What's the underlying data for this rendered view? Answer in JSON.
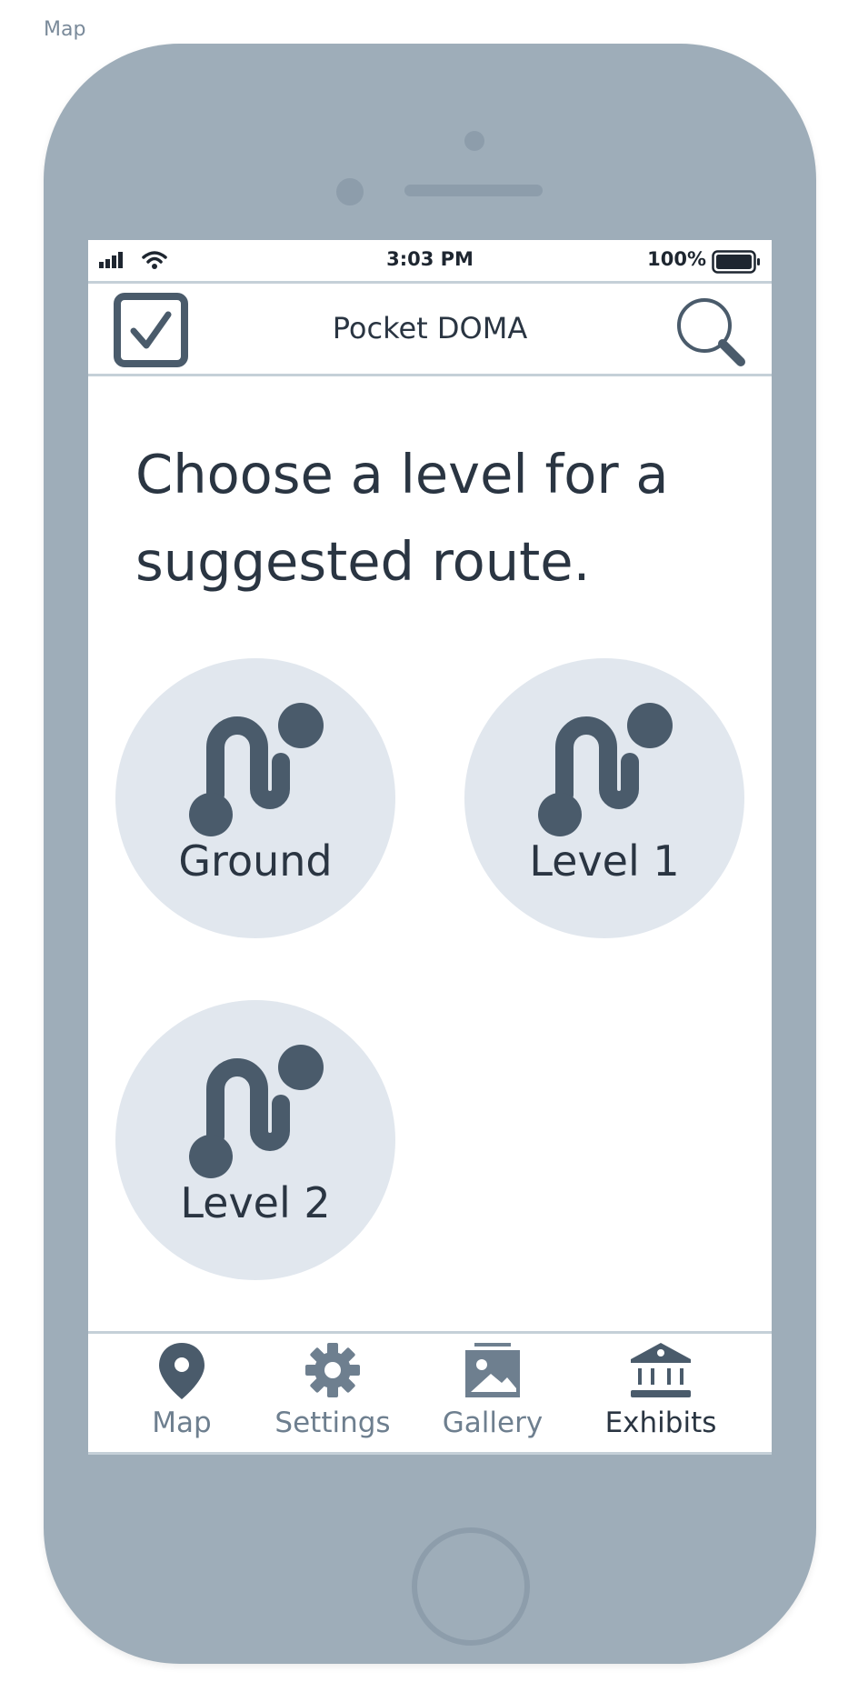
{
  "frame_label": "Map",
  "status_bar": {
    "time": "3:03 PM",
    "battery": "100%",
    "icons": [
      "signal-icon",
      "wifi-icon",
      "battery-icon"
    ]
  },
  "nav_bar": {
    "title": "Pocket DOMA",
    "left_icon": "checkbox-icon",
    "right_icon": "search-icon"
  },
  "headline": "Choose a level for a suggested route.",
  "levels": [
    {
      "label": "Ground",
      "icon": "route-icon"
    },
    {
      "label": "Level 1",
      "icon": "route-icon"
    },
    {
      "label": "Level 2",
      "icon": "route-icon"
    }
  ],
  "tabs": [
    {
      "label": "Map",
      "icon": "map-pin-icon",
      "active": false
    },
    {
      "label": "Settings",
      "icon": "gear-icon",
      "active": false
    },
    {
      "label": "Gallery",
      "icon": "gallery-icon",
      "active": false
    },
    {
      "label": "Exhibits",
      "icon": "museum-icon",
      "active": true
    }
  ],
  "colors": {
    "device": "#9eadb9",
    "text_dark": "#2a3542",
    "icon_dark": "#4a5b6b",
    "tab_inactive": "#6e7f8f",
    "level_bg": "#e1e7ee",
    "divider": "#c5d0d8"
  }
}
